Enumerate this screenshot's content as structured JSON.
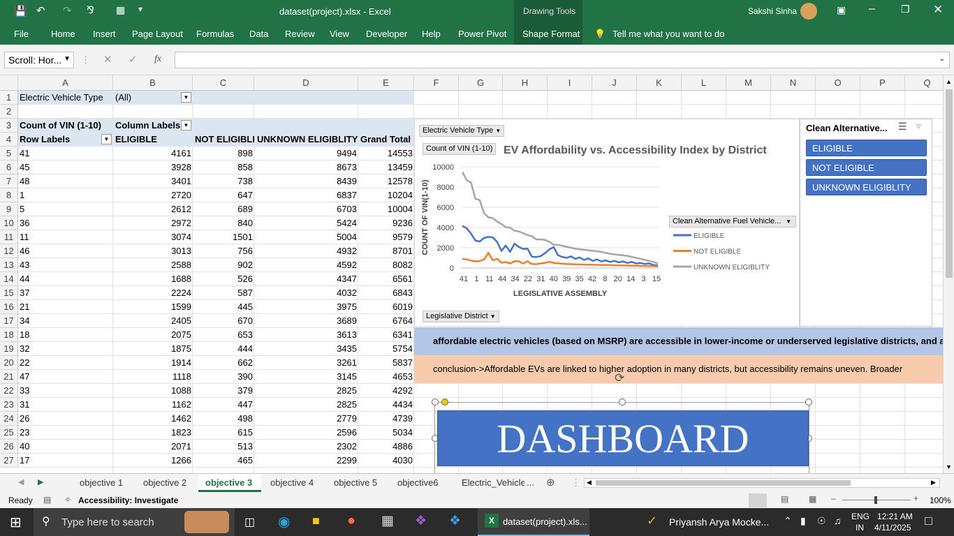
{
  "title": {
    "file": "dataset(project).xlsx",
    "app": "Excel",
    "drawing_tools": "Drawing Tools",
    "user": "Sakshi Sinha"
  },
  "ribbon": {
    "tabs": [
      "File",
      "Home",
      "Insert",
      "Page Layout",
      "Formulas",
      "Data",
      "Review",
      "View",
      "Developer",
      "Help",
      "Power Pivot",
      "Shape Format"
    ],
    "tell_me": "Tell me what you want to do"
  },
  "formula_bar": {
    "name_box": "Scroll: Hor...",
    "fx": "fx",
    "value": ""
  },
  "columns": [
    "A",
    "B",
    "C",
    "D",
    "E",
    "F",
    "G",
    "H",
    "I",
    "J",
    "K",
    "L",
    "M",
    "N",
    "O",
    "P",
    "Q"
  ],
  "rows": [
    "1",
    "2",
    "3",
    "4",
    "5",
    "6",
    "7",
    "8",
    "9",
    "10",
    "11",
    "12",
    "13",
    "14",
    "15",
    "16",
    "17",
    "18",
    "19",
    "20",
    "21",
    "22",
    "23",
    "24",
    "25",
    "26",
    "27"
  ],
  "pivot": {
    "filter_label": "Electric Vehicle Type",
    "filter_value": "(All)",
    "count_label": "Count of VIN (1-10)",
    "column_labels": "Column Labels",
    "row_labels": "Row Labels",
    "headers": [
      "ELIGIBLE",
      "NOT ELIGIBLE",
      "UNKNOWN ELIGIBLITY",
      "Grand Total"
    ],
    "data": [
      [
        "41",
        "4161",
        "898",
        "9494",
        "14553"
      ],
      [
        "45",
        "3928",
        "858",
        "8673",
        "13459"
      ],
      [
        "48",
        "3401",
        "738",
        "8439",
        "12578"
      ],
      [
        "1",
        "2720",
        "647",
        "6837",
        "10204"
      ],
      [
        "5",
        "2612",
        "689",
        "6703",
        "10004"
      ],
      [
        "36",
        "2972",
        "840",
        "5424",
        "9236"
      ],
      [
        "11",
        "3074",
        "1501",
        "5004",
        "9579"
      ],
      [
        "46",
        "3013",
        "756",
        "4932",
        "8701"
      ],
      [
        "43",
        "2588",
        "902",
        "4592",
        "8082"
      ],
      [
        "44",
        "1688",
        "526",
        "4347",
        "6561"
      ],
      [
        "37",
        "2224",
        "587",
        "4032",
        "6843"
      ],
      [
        "21",
        "1599",
        "445",
        "3975",
        "6019"
      ],
      [
        "34",
        "2405",
        "670",
        "3689",
        "6764"
      ],
      [
        "18",
        "2075",
        "653",
        "3613",
        "6341"
      ],
      [
        "32",
        "1875",
        "444",
        "3435",
        "5754"
      ],
      [
        "22",
        "1914",
        "662",
        "3261",
        "5837"
      ],
      [
        "47",
        "1118",
        "390",
        "3145",
        "4653"
      ],
      [
        "33",
        "1088",
        "379",
        "2825",
        "4292"
      ],
      [
        "31",
        "1162",
        "447",
        "2825",
        "4434"
      ],
      [
        "26",
        "1462",
        "498",
        "2779",
        "4739"
      ],
      [
        "23",
        "1823",
        "615",
        "2596",
        "5034"
      ],
      [
        "40",
        "2071",
        "513",
        "2302",
        "4886"
      ],
      [
        "17",
        "1266",
        "465",
        "2299",
        "4030"
      ]
    ]
  },
  "chart": {
    "filter_btn": "Electric Vehicle Type",
    "value_btn": "Count of VIN (1-10)",
    "axis_btn": "Legislative District",
    "legend_btn": "Clean Alternative Fuel Vehicle...",
    "colors": {
      "eligible": "#4472c4",
      "not_eligible": "#ed7d31",
      "unknown": "#a5a5a5"
    }
  },
  "chart_data": {
    "type": "line",
    "title": "EV Affordability vs. Accessibility Index by District",
    "xlabel": "LEGISLATIVE ASSEMBLY",
    "ylabel": "COUNT OF VIN(1-10)",
    "ylim": [
      0,
      10000
    ],
    "yticks": [
      "0",
      "2000",
      "4000",
      "6000",
      "8000",
      "10000"
    ],
    "x": [
      "41",
      "1",
      "11",
      "44",
      "34",
      "22",
      "31",
      "40",
      "39",
      "35",
      "42",
      "8",
      "20",
      "14",
      "3",
      "15"
    ],
    "series": [
      {
        "name": "ELIGIBLE",
        "values": [
          4161,
          3928,
          3401,
          2720,
          2612,
          2972,
          3074,
          3013,
          2588,
          1688,
          2224,
          1599,
          2405,
          2075,
          1875,
          1914,
          1118,
          1088,
          1162,
          1462,
          1823,
          2071,
          1266,
          1100,
          1000,
          1150,
          900,
          1050,
          800,
          950,
          700,
          850,
          650,
          750,
          600,
          700,
          550,
          650,
          500,
          600,
          450,
          500,
          400,
          450,
          300,
          250
        ]
      },
      {
        "name": "NOT ELIGIBLE",
        "values": [
          898,
          858,
          738,
          647,
          689,
          840,
          1501,
          756,
          902,
          526,
          587,
          445,
          670,
          653,
          444,
          662,
          390,
          379,
          447,
          498,
          615,
          513,
          465,
          420,
          400,
          380,
          360,
          350,
          340,
          330,
          320,
          310,
          300,
          290,
          280,
          270,
          260,
          250,
          240,
          230,
          220,
          210,
          200,
          190,
          180,
          150
        ]
      },
      {
        "name": "UNKNOWN ELIGIBLITY",
        "values": [
          9494,
          8673,
          8439,
          6837,
          6703,
          5424,
          5004,
          4932,
          4592,
          4347,
          4032,
          3975,
          3689,
          3613,
          3435,
          3261,
          3145,
          2825,
          2825,
          2779,
          2596,
          2302,
          2299,
          2200,
          2100,
          2000,
          1900,
          1850,
          1800,
          1750,
          1700,
          1650,
          1600,
          1500,
          1400,
          1350,
          1300,
          1250,
          1200,
          1100,
          1000,
          900,
          800,
          700,
          600,
          450
        ]
      }
    ]
  },
  "slicer": {
    "title": "Clean Alternative...",
    "items": [
      "ELIGIBLE",
      "NOT ELIGIBLE",
      "UNKNOWN ELIGIBLITY"
    ]
  },
  "text_boxes": {
    "band1": "affordable electric vehicles (based on MSRP) are accessible in lower-income or underserved legislative districts, and a",
    "band2": "conclusion->Affordable EVs are linked to higher adoption in many districts, but accessibility remains uneven. Broader"
  },
  "dashboard": "DASHBOARD",
  "sheet_tabs": [
    "objective 1",
    "objective 2",
    "objective 3",
    "objective 4",
    "objective 5",
    "objective6",
    "Electric_Vehicle_"
  ],
  "active_tab": "objective 3",
  "status": {
    "ready": "Ready",
    "accessibility": "Accessibility: Investigate",
    "zoom": "100%"
  },
  "taskbar": {
    "search": "Type here to search",
    "excel_item": "dataset(project).xls...",
    "task2": "Priyansh Arya Mocke...",
    "lang1": "ENG",
    "lang2": "IN",
    "time": "12:21 AM",
    "date": "4/11/2025"
  }
}
